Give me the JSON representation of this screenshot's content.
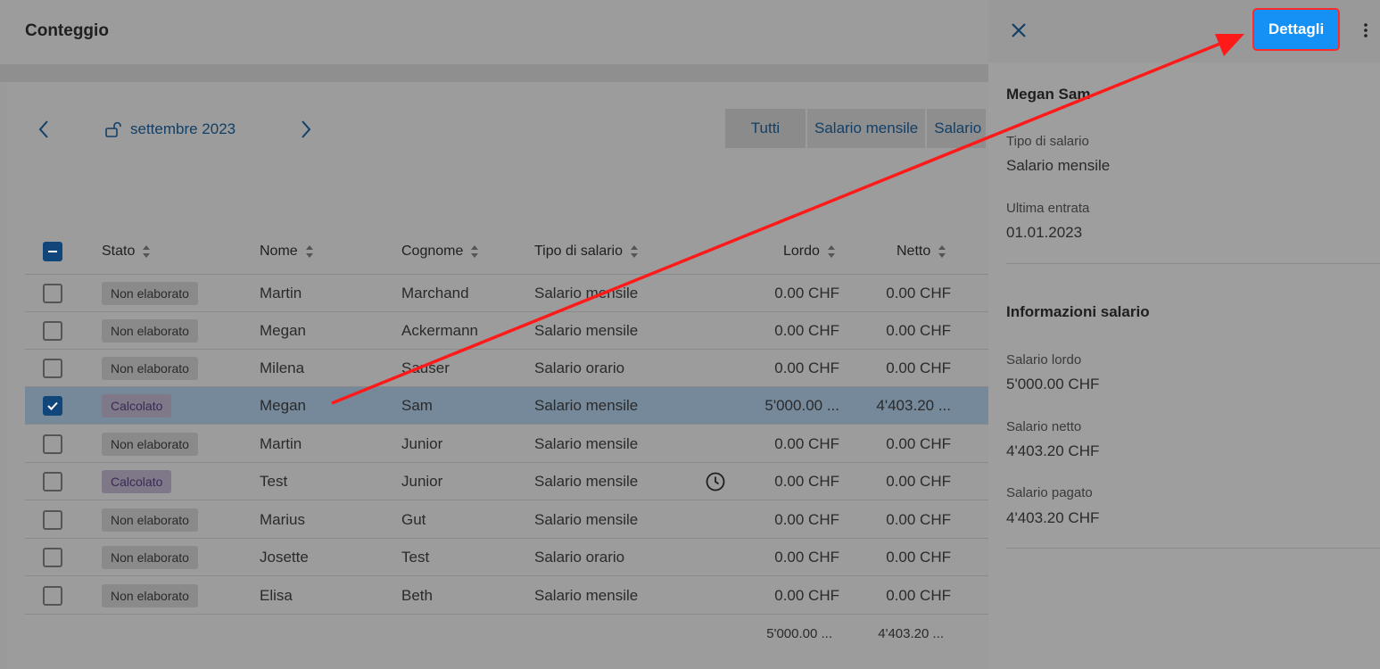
{
  "header": {
    "title": "Conteggio"
  },
  "period": {
    "label": "settembre 2023"
  },
  "filters": [
    {
      "label": "Tutti",
      "active": true
    },
    {
      "label": "Salario mensile"
    },
    {
      "label": "Salario"
    }
  ],
  "table": {
    "columns": {
      "stato": "Stato",
      "nome": "Nome",
      "cognome": "Cognome",
      "tipo": "Tipo di salario",
      "lordo": "Lordo",
      "netto": "Netto"
    },
    "rows": [
      {
        "stato": "Non elaborato",
        "nome": "Martin",
        "cognome": "Marchand",
        "tipo": "Salario mensile",
        "lordo": "0.00 CHF",
        "netto": "0.00 CHF",
        "checked": false
      },
      {
        "stato": "Non elaborato",
        "nome": "Megan",
        "cognome": "Ackermann",
        "tipo": "Salario mensile",
        "lordo": "0.00 CHF",
        "netto": "0.00 CHF",
        "checked": false
      },
      {
        "stato": "Non elaborato",
        "nome": "Milena",
        "cognome": "Sauser",
        "tipo": "Salario orario",
        "lordo": "0.00 CHF",
        "netto": "0.00 CHF",
        "checked": false
      },
      {
        "stato": "Calcolato",
        "nome": "Megan",
        "cognome": "Sam",
        "tipo": "Salario mensile",
        "lordo": "5'000.00 ...",
        "netto": "4'403.20 ...",
        "checked": true
      },
      {
        "stato": "Non elaborato",
        "nome": "Martin",
        "cognome": "Junior",
        "tipo": "Salario mensile",
        "lordo": "0.00 CHF",
        "netto": "0.00 CHF",
        "checked": false
      },
      {
        "stato": "Calcolato",
        "nome": "Test",
        "cognome": "Junior",
        "tipo": "Salario mensile",
        "lordo": "0.00 CHF",
        "netto": "0.00 CHF",
        "checked": false,
        "clock": true
      },
      {
        "stato": "Non elaborato",
        "nome": "Marius",
        "cognome": "Gut",
        "tipo": "Salario mensile",
        "lordo": "0.00 CHF",
        "netto": "0.00 CHF",
        "checked": false
      },
      {
        "stato": "Non elaborato",
        "nome": "Josette",
        "cognome": "Test",
        "tipo": "Salario orario",
        "lordo": "0.00 CHF",
        "netto": "0.00 CHF",
        "checked": false
      },
      {
        "stato": "Non elaborato",
        "nome": "Elisa",
        "cognome": "Beth",
        "tipo": "Salario mensile",
        "lordo": "0.00 CHF",
        "netto": "0.00 CHF",
        "checked": false
      }
    ],
    "totals": {
      "lordo": "5'000.00 ...",
      "netto": "4'403.20 ..."
    }
  },
  "panel": {
    "details_label": "Dettagli",
    "employee_name": "Megan Sam",
    "tipo_label": "Tipo di salario",
    "tipo_value": "Salario mensile",
    "entrata_label": "Ultima entrata",
    "entrata_value": "01.01.2023",
    "info_title": "Informazioni salario",
    "lordo_label": "Salario lordo",
    "lordo_value": "5'000.00 CHF",
    "netto_label": "Salario netto",
    "netto_value": "4'403.20 CHF",
    "pagato_label": "Salario pagato",
    "pagato_value": "4'403.20 CHF"
  },
  "colors": {
    "accent": "#123f66",
    "primary_button": "#1590f5",
    "annotation_arrow": "#ff1a1a"
  }
}
